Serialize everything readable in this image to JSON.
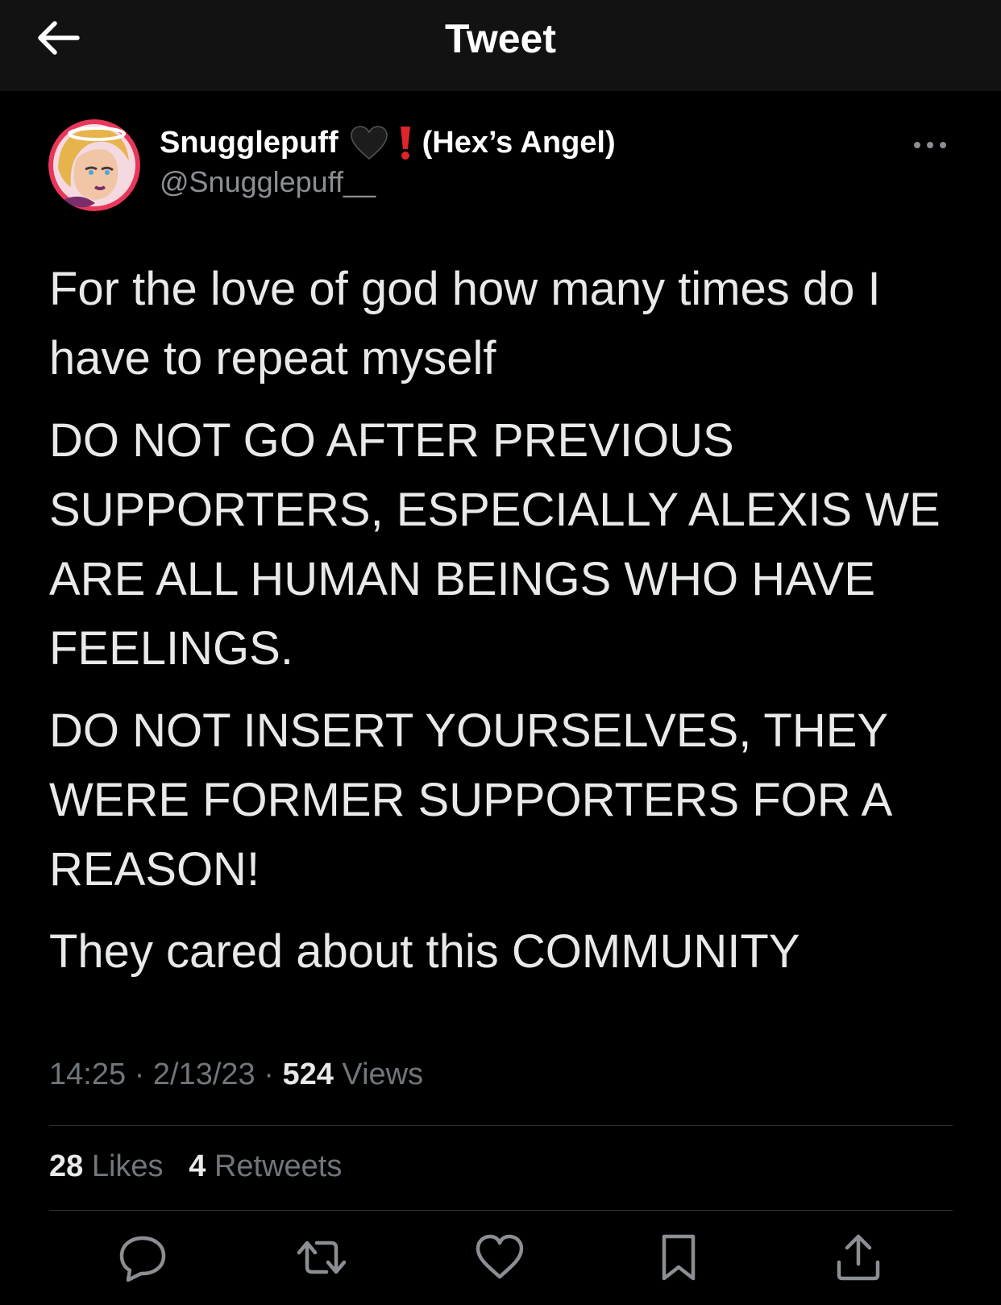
{
  "header": {
    "title": "Tweet",
    "back_icon": "arrow-left-icon"
  },
  "author": {
    "display_name": "Snugglepuff",
    "display_suffix": "(Hex’s Angel)",
    "name_emojis": [
      "black-heart",
      "red-exclamation"
    ],
    "handle": "@Snugglepuff__"
  },
  "tweet": {
    "paragraphs": [
      "For the love of god how many times do I have to repeat myself",
      "DO NOT GO AFTER PREVIOUS SUPPORTERS, ESPECIALLY ALEXIS WE ARE ALL HUMAN BEINGS WHO HAVE FEELINGS.",
      "DO NOT INSERT YOURSELVES, THEY WERE FORMER SUPPORTERS FOR A REASON!",
      "They cared about this COMMUNITY"
    ]
  },
  "meta": {
    "time": "14:25",
    "date": "2/13/23",
    "sep": "·",
    "views_count": "524",
    "views_label": "Views"
  },
  "stats": {
    "likes_count": "28",
    "likes_label": "Likes",
    "retweets_count": "4",
    "retweets_label": "Retweets"
  },
  "actions": [
    "reply-icon",
    "retweet-icon",
    "like-icon",
    "bookmark-icon",
    "share-icon"
  ],
  "colors": {
    "background": "#000000",
    "header": "#121212",
    "text": "#e7e9ea",
    "muted": "#71767b",
    "divider": "#2f3336"
  }
}
